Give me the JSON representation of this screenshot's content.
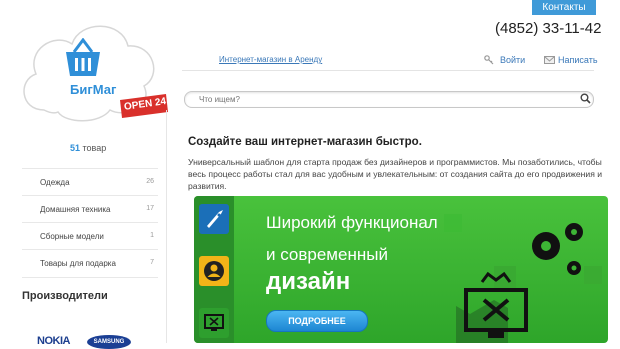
{
  "header": {
    "contacts_label": "Контакты",
    "phone": "(4852) 33-11-42",
    "rent_link": "Интернет-магазин в Аренду",
    "login_label": "Войти",
    "write_label": "Написать",
    "search_placeholder": "Что ищем?"
  },
  "logo": {
    "name": "БигМаг",
    "badge": "OPEN 24"
  },
  "sidebar": {
    "count_number": "51",
    "count_label": "товар",
    "categories": [
      {
        "label": "Одежда",
        "count": "26"
      },
      {
        "label": "Домашняя техника",
        "count": "17"
      },
      {
        "label": "Сборные модели",
        "count": "1"
      },
      {
        "label": "Товары для подарка",
        "count": "7"
      }
    ],
    "makers_title": "Производители",
    "brands": [
      "NOKIA",
      "SAMSUNG"
    ]
  },
  "main": {
    "title": "Создайте ваш интернет-магазин быстро.",
    "description": "Универсальный шаблон для старта продаж без дизайнеров и программистов. Мы позаботились, чтобы весь процесс работы стал для вас удобным и увлекательным: от создания сайта до его продвижения и развития.",
    "banner": {
      "line1": "Широкий функционал",
      "line2": "и современный",
      "line3": "дизайн",
      "button": "ПОДРОБНЕЕ"
    }
  },
  "colors": {
    "accent": "#3f9ad8",
    "banner_green": "#3db535",
    "badge_red": "#d9302b"
  }
}
